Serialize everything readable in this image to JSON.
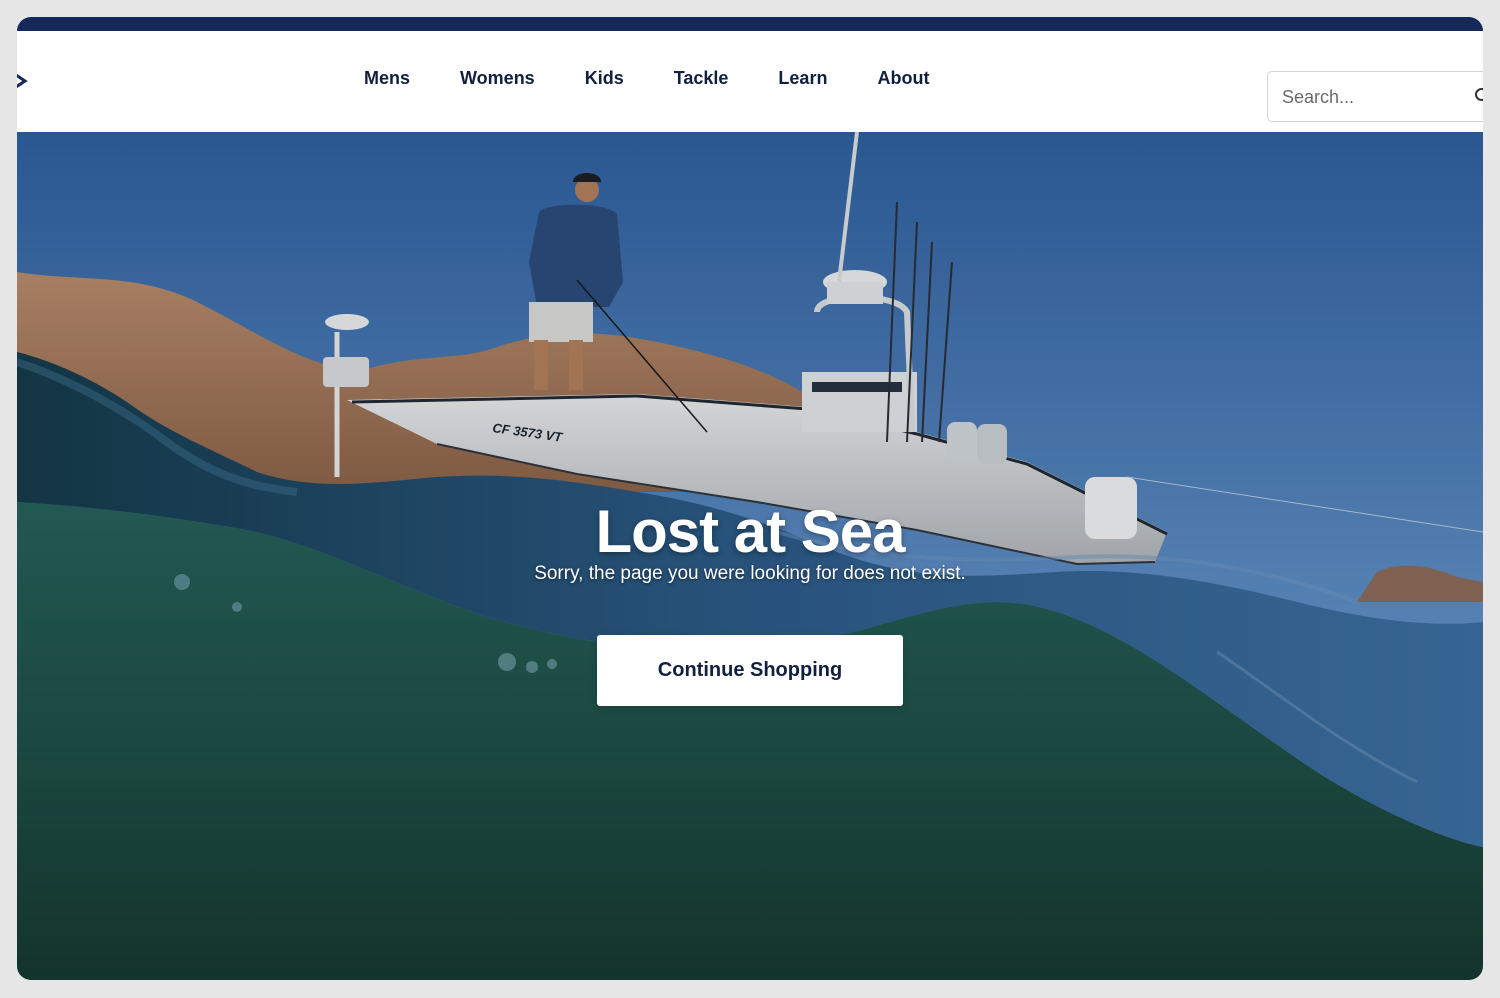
{
  "nav": {
    "items": [
      {
        "label": "Mens"
      },
      {
        "label": "Womens"
      },
      {
        "label": "Kids"
      },
      {
        "label": "Tackle"
      },
      {
        "label": "Learn"
      },
      {
        "label": "About"
      }
    ]
  },
  "search": {
    "placeholder": "Search...",
    "icon": "search-icon"
  },
  "hero": {
    "title": "Lost at Sea",
    "subtitle": "Sorry, the page you were looking for does not exist.",
    "cta_label": "Continue Shopping",
    "boat_hull_text": "CF 3573 VT"
  },
  "colors": {
    "brand_navy": "#15285a",
    "nav_text": "#12203f",
    "sky": "#4a7bb6",
    "water": "#1f5048"
  }
}
